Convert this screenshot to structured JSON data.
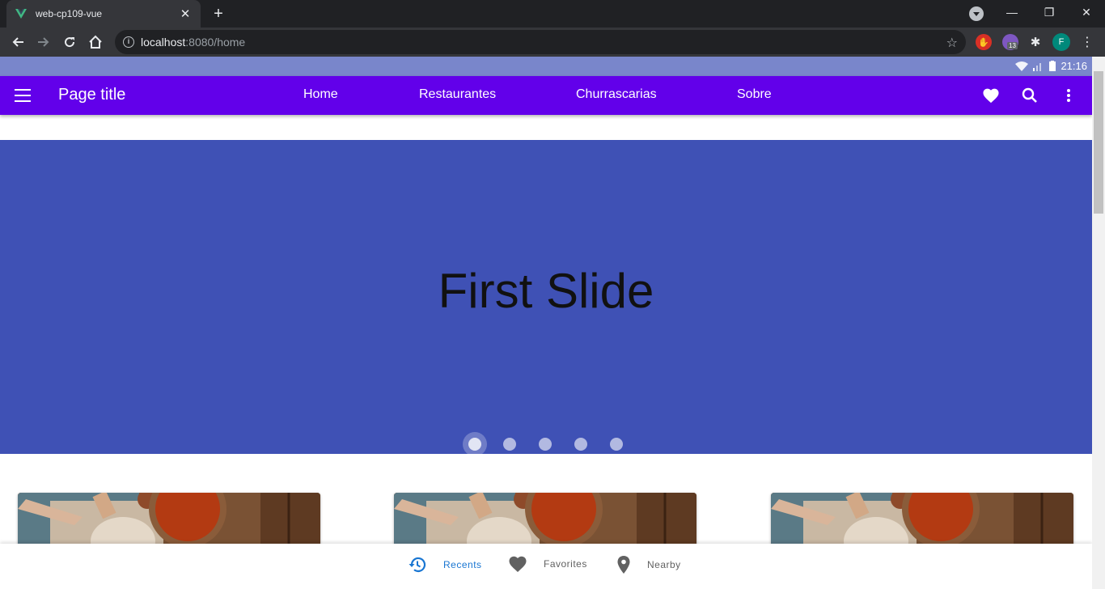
{
  "browser": {
    "tab_title": "web-cp109-vue",
    "url_host": "localhost",
    "url_rest": ":8080/home",
    "profile_initial": "F",
    "extension_badge": "13"
  },
  "status_bar": {
    "time": "21:16"
  },
  "app_bar": {
    "title": "Page title",
    "nav": [
      "Home",
      "Restaurantes",
      "Churrascarias",
      "Sobre"
    ],
    "color": "#6200ea"
  },
  "carousel": {
    "slide_text": "First Slide",
    "slide_count": 5,
    "active_index": 0,
    "color": "#3f51b5"
  },
  "bottom_nav": {
    "items": [
      {
        "label": "Recents",
        "icon": "history-icon",
        "active": true
      },
      {
        "label": "Favorites",
        "icon": "heart-icon",
        "active": false
      },
      {
        "label": "Nearby",
        "icon": "location-pin-icon",
        "active": false
      }
    ],
    "active_color": "#1976d2",
    "inactive_color": "#616161"
  }
}
